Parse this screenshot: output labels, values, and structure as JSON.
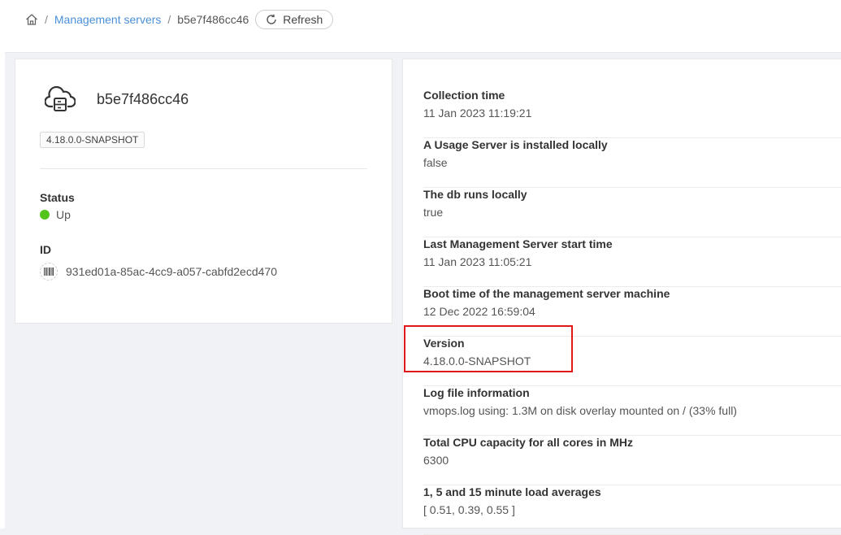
{
  "breadcrumb": {
    "parent": "Management servers",
    "current": "b5e7f486cc46",
    "refresh_label": "Refresh"
  },
  "server": {
    "name": "b5e7f486cc46",
    "version_tag": "4.18.0.0-SNAPSHOT",
    "status_label": "Status",
    "status_value": "Up",
    "id_label": "ID",
    "id_value": "931ed01a-85ac-4cc9-a057-cabfd2ecd470"
  },
  "details": [
    {
      "label": "Collection time",
      "value": "11 Jan 2023 11:19:21"
    },
    {
      "label": "A Usage Server is installed locally",
      "value": "false"
    },
    {
      "label": "The db runs locally",
      "value": "true"
    },
    {
      "label": "Last Management Server start time",
      "value": "11 Jan 2023 11:05:21"
    },
    {
      "label": "Boot time of the management server machine",
      "value": "12 Dec 2022 16:59:04"
    },
    {
      "label": "Version",
      "value": "4.18.0.0-SNAPSHOT"
    },
    {
      "label": "Log file information",
      "value": "vmops.log using: 1.3M on disk overlay mounted on / (33% full)"
    },
    {
      "label": "Total CPU capacity for all cores in MHz",
      "value": "6300"
    },
    {
      "label": "1, 5 and 15 minute load averages",
      "value": "[ 0.51, 0.39, 0.55 ]"
    }
  ],
  "colors": {
    "link": "#4a90d9",
    "status_up": "#52c41a",
    "highlight": "#e01818"
  },
  "icons": [
    "home-icon",
    "refresh-icon",
    "cloud-server-icon",
    "barcode-icon"
  ]
}
